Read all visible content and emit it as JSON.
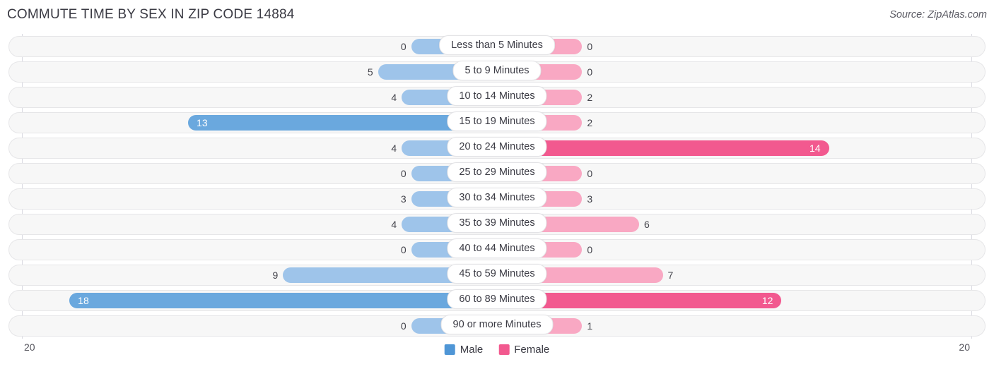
{
  "header": {
    "title": "COMMUTE TIME BY SEX IN ZIP CODE 14884",
    "source": "Source: ZipAtlas.com"
  },
  "colors": {
    "male_light": "#9ec4ea",
    "male_strong": "#6aa8de",
    "female_light": "#f9a8c3",
    "female_strong": "#f2598f"
  },
  "axis": {
    "left_tick": "20",
    "right_tick": "20",
    "max": 20
  },
  "legend": {
    "items": [
      {
        "label": "Male",
        "color": "#4f96d6"
      },
      {
        "label": "Female",
        "color": "#f2598f"
      }
    ]
  },
  "chart_data": {
    "type": "bar",
    "title": "COMMUTE TIME BY SEX IN ZIP CODE 14884",
    "subtitle": "Source: ZipAtlas.com",
    "orientation": "horizontal-diverging",
    "xlabel": "",
    "ylabel": "",
    "xlim": [
      20,
      20
    ],
    "grid": false,
    "legend_position": "bottom-center",
    "categories": [
      "Less than 5 Minutes",
      "5 to 9 Minutes",
      "10 to 14 Minutes",
      "15 to 19 Minutes",
      "20 to 24 Minutes",
      "25 to 29 Minutes",
      "30 to 34 Minutes",
      "35 to 39 Minutes",
      "40 to 44 Minutes",
      "45 to 59 Minutes",
      "60 to 89 Minutes",
      "90 or more Minutes"
    ],
    "series": [
      {
        "name": "Male",
        "values": [
          0,
          5,
          4,
          13,
          4,
          0,
          3,
          4,
          0,
          9,
          18,
          0
        ]
      },
      {
        "name": "Female",
        "values": [
          0,
          0,
          2,
          2,
          14,
          0,
          3,
          6,
          0,
          7,
          12,
          1
        ]
      }
    ]
  },
  "rows": [
    {
      "label": "Less than 5 Minutes",
      "male": "0",
      "female": "0",
      "male_value": 0,
      "female_value": 0
    },
    {
      "label": "5 to 9 Minutes",
      "male": "5",
      "female": "0",
      "male_value": 5,
      "female_value": 0
    },
    {
      "label": "10 to 14 Minutes",
      "male": "4",
      "female": "2",
      "male_value": 4,
      "female_value": 2
    },
    {
      "label": "15 to 19 Minutes",
      "male": "13",
      "female": "2",
      "male_value": 13,
      "female_value": 2
    },
    {
      "label": "20 to 24 Minutes",
      "male": "4",
      "female": "14",
      "male_value": 4,
      "female_value": 14
    },
    {
      "label": "25 to 29 Minutes",
      "male": "0",
      "female": "0",
      "male_value": 0,
      "female_value": 0
    },
    {
      "label": "30 to 34 Minutes",
      "male": "3",
      "female": "3",
      "male_value": 3,
      "female_value": 3
    },
    {
      "label": "35 to 39 Minutes",
      "male": "4",
      "female": "6",
      "male_value": 4,
      "female_value": 6
    },
    {
      "label": "40 to 44 Minutes",
      "male": "0",
      "female": "0",
      "male_value": 0,
      "female_value": 0
    },
    {
      "label": "45 to 59 Minutes",
      "male": "9",
      "female": "7",
      "male_value": 9,
      "female_value": 7
    },
    {
      "label": "60 to 89 Minutes",
      "male": "18",
      "female": "12",
      "male_value": 18,
      "female_value": 12
    },
    {
      "label": "90 or more Minutes",
      "male": "0",
      "female": "1",
      "male_value": 0,
      "female_value": 1
    }
  ]
}
